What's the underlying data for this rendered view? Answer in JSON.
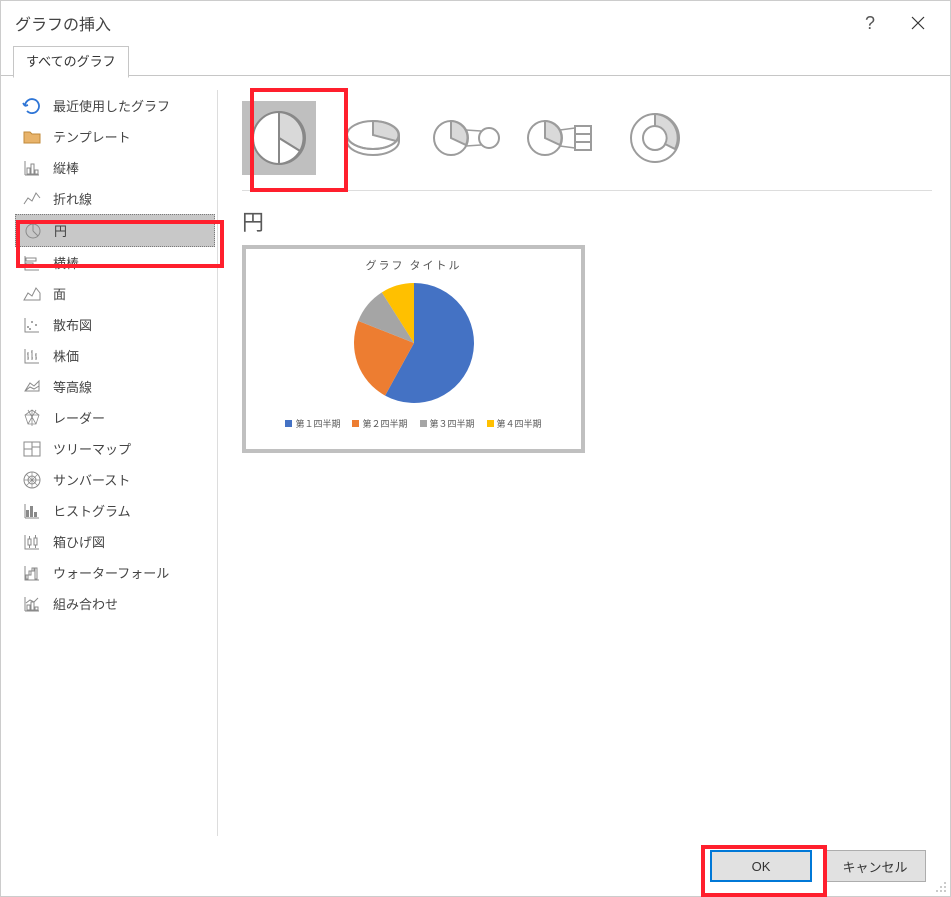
{
  "title": "グラフの挿入",
  "tabs": {
    "all": "すべてのグラフ"
  },
  "sidebar": {
    "items": [
      {
        "label": "最近使用したグラフ",
        "icon": "recent"
      },
      {
        "label": "テンプレート",
        "icon": "folder"
      },
      {
        "label": "縦棒",
        "icon": "column"
      },
      {
        "label": "折れ線",
        "icon": "line"
      },
      {
        "label": "円",
        "icon": "pie"
      },
      {
        "label": "横棒",
        "icon": "bar"
      },
      {
        "label": "面",
        "icon": "area"
      },
      {
        "label": "散布図",
        "icon": "scatter"
      },
      {
        "label": "株価",
        "icon": "stock"
      },
      {
        "label": "等高線",
        "icon": "surface"
      },
      {
        "label": "レーダー",
        "icon": "radar"
      },
      {
        "label": "ツリーマップ",
        "icon": "treemap"
      },
      {
        "label": "サンバースト",
        "icon": "sunburst"
      },
      {
        "label": "ヒストグラム",
        "icon": "histogram"
      },
      {
        "label": "箱ひげ図",
        "icon": "boxwhisker"
      },
      {
        "label": "ウォーターフォール",
        "icon": "waterfall"
      },
      {
        "label": "組み合わせ",
        "icon": "combo"
      }
    ]
  },
  "subtype_title": "円",
  "preview": {
    "title": "グラフ タイトル"
  },
  "buttons": {
    "ok": "OK",
    "cancel": "キャンセル"
  },
  "chart_data": {
    "type": "pie",
    "title": "グラフ タイトル",
    "categories": [
      "第１四半期",
      "第２四半期",
      "第３四半期",
      "第４四半期"
    ],
    "values": [
      58,
      23,
      10,
      9
    ],
    "colors": [
      "#4472c4",
      "#ed7d31",
      "#a5a5a5",
      "#ffc000"
    ],
    "legend": {
      "position": "bottom",
      "entries": [
        "第１四半期",
        "第２四半期",
        "第３四半期",
        "第４四半期"
      ]
    }
  }
}
